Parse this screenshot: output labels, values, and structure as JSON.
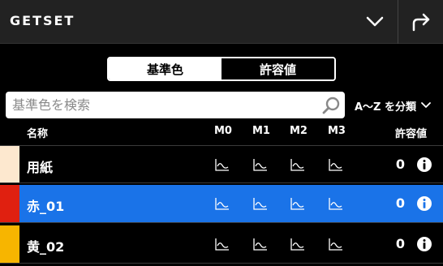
{
  "header": {
    "title": "GETSET",
    "icons": [
      "chevron-down-icon",
      "share-forward-icon"
    ]
  },
  "segment": {
    "items": [
      {
        "label": "基準色",
        "active": true
      },
      {
        "label": "許容値",
        "active": false
      }
    ]
  },
  "search": {
    "placeholder": "基準色を検索",
    "value": "",
    "icon": "search-icon"
  },
  "sort": {
    "label": "A〜Z を分類",
    "icon": "chevron-down-icon"
  },
  "table": {
    "columns": {
      "name": "名称",
      "m0": "M0",
      "m1": "M1",
      "m2": "M2",
      "m3": "M3",
      "tolerance": "許容値"
    },
    "rows": [
      {
        "name": "用紙",
        "tolerance": "0",
        "swatch": "#fde8cf",
        "selected": false
      },
      {
        "name": "赤_01",
        "tolerance": "0",
        "swatch": "#e02010",
        "selected": true
      },
      {
        "name": "黄_02",
        "tolerance": "0",
        "swatch": "#f7b500",
        "selected": false
      }
    ]
  },
  "colors": {
    "accent": "#1a73e8",
    "header_bg": "#222222",
    "background": "#000000"
  }
}
